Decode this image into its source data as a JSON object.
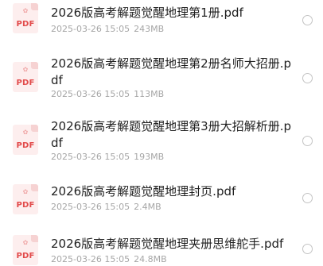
{
  "icon": {
    "label": "PDF",
    "glyph": "acrobat-icon",
    "label_color": "#e24a4a",
    "bg_color": "#fdeeee"
  },
  "files": [
    {
      "name": "2026版高考解题觉醒地理第1册.pdf",
      "date": "2025-03-26 15:05",
      "size": "243MB",
      "selected": false
    },
    {
      "name": "2026版高考解题觉醒地理第2册名师大招册.pdf",
      "date": "2025-03-26 15:05",
      "size": "113MB",
      "selected": false
    },
    {
      "name": "2026版高考解题觉醒地理第3册大招解析册.pdf",
      "date": "2025-03-26 15:05",
      "size": "193MB",
      "selected": false
    },
    {
      "name": "2026版高考解题觉醒地理封页.pdf",
      "date": "2025-03-26 15:05",
      "size": "2.4MB",
      "selected": false
    },
    {
      "name": "2026版高考解题觉醒地理夹册思维舵手.pdf",
      "date": "2025-03-26 15:05",
      "size": "24.8MB",
      "selected": false
    }
  ]
}
